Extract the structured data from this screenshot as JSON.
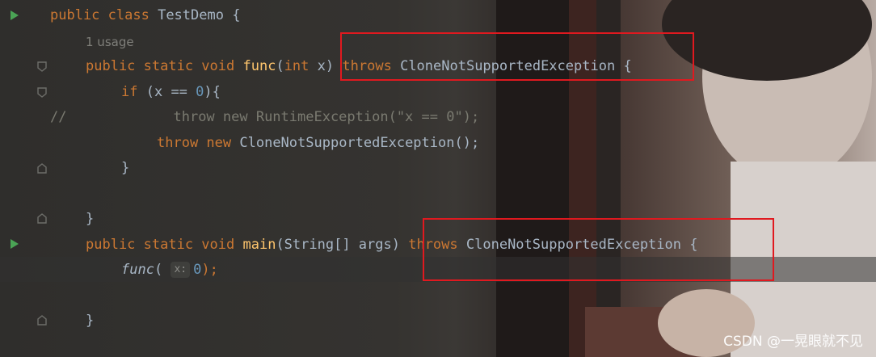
{
  "code": {
    "line1": {
      "kw": "public class",
      "name": "TestDemo",
      "brace": "{"
    },
    "usage": "1 usage",
    "line3": {
      "mods": "public static void",
      "fn": "func",
      "paren_open": "(",
      "type": "int",
      "param": "x",
      "paren_close": ")",
      "throws": "throws",
      "exc": "CloneNotSupportedException",
      "brace": "{"
    },
    "line4": {
      "kw": "if",
      "cond_open": "(x ==",
      "num": "0",
      "cond_close": "){"
    },
    "line5": {
      "prefix": "//",
      "text": "throw new RuntimeException(\"x == 0\");"
    },
    "line6": {
      "throw": "throw new",
      "exc": "CloneNotSupportedException();"
    },
    "line7": "}",
    "line9": "}",
    "line10": {
      "mods": "public static void",
      "fn": "main",
      "sig": "(String[] args)",
      "throws": "throws",
      "exc": "CloneNotSupportedException",
      "brace": "{"
    },
    "line11": {
      "fn": "func",
      "paren_open": "(",
      "hint": "x:",
      "num": "0",
      "tail": ");"
    },
    "line13": "}"
  },
  "watermark": "CSDN @一晃眼就不见",
  "colors": {
    "keyword": "#cc7832",
    "function": "#ffc66d",
    "number": "#6897bb",
    "text": "#a9b7c6",
    "highlight_box": "#e0191f",
    "run_icon": "#4aa455"
  }
}
